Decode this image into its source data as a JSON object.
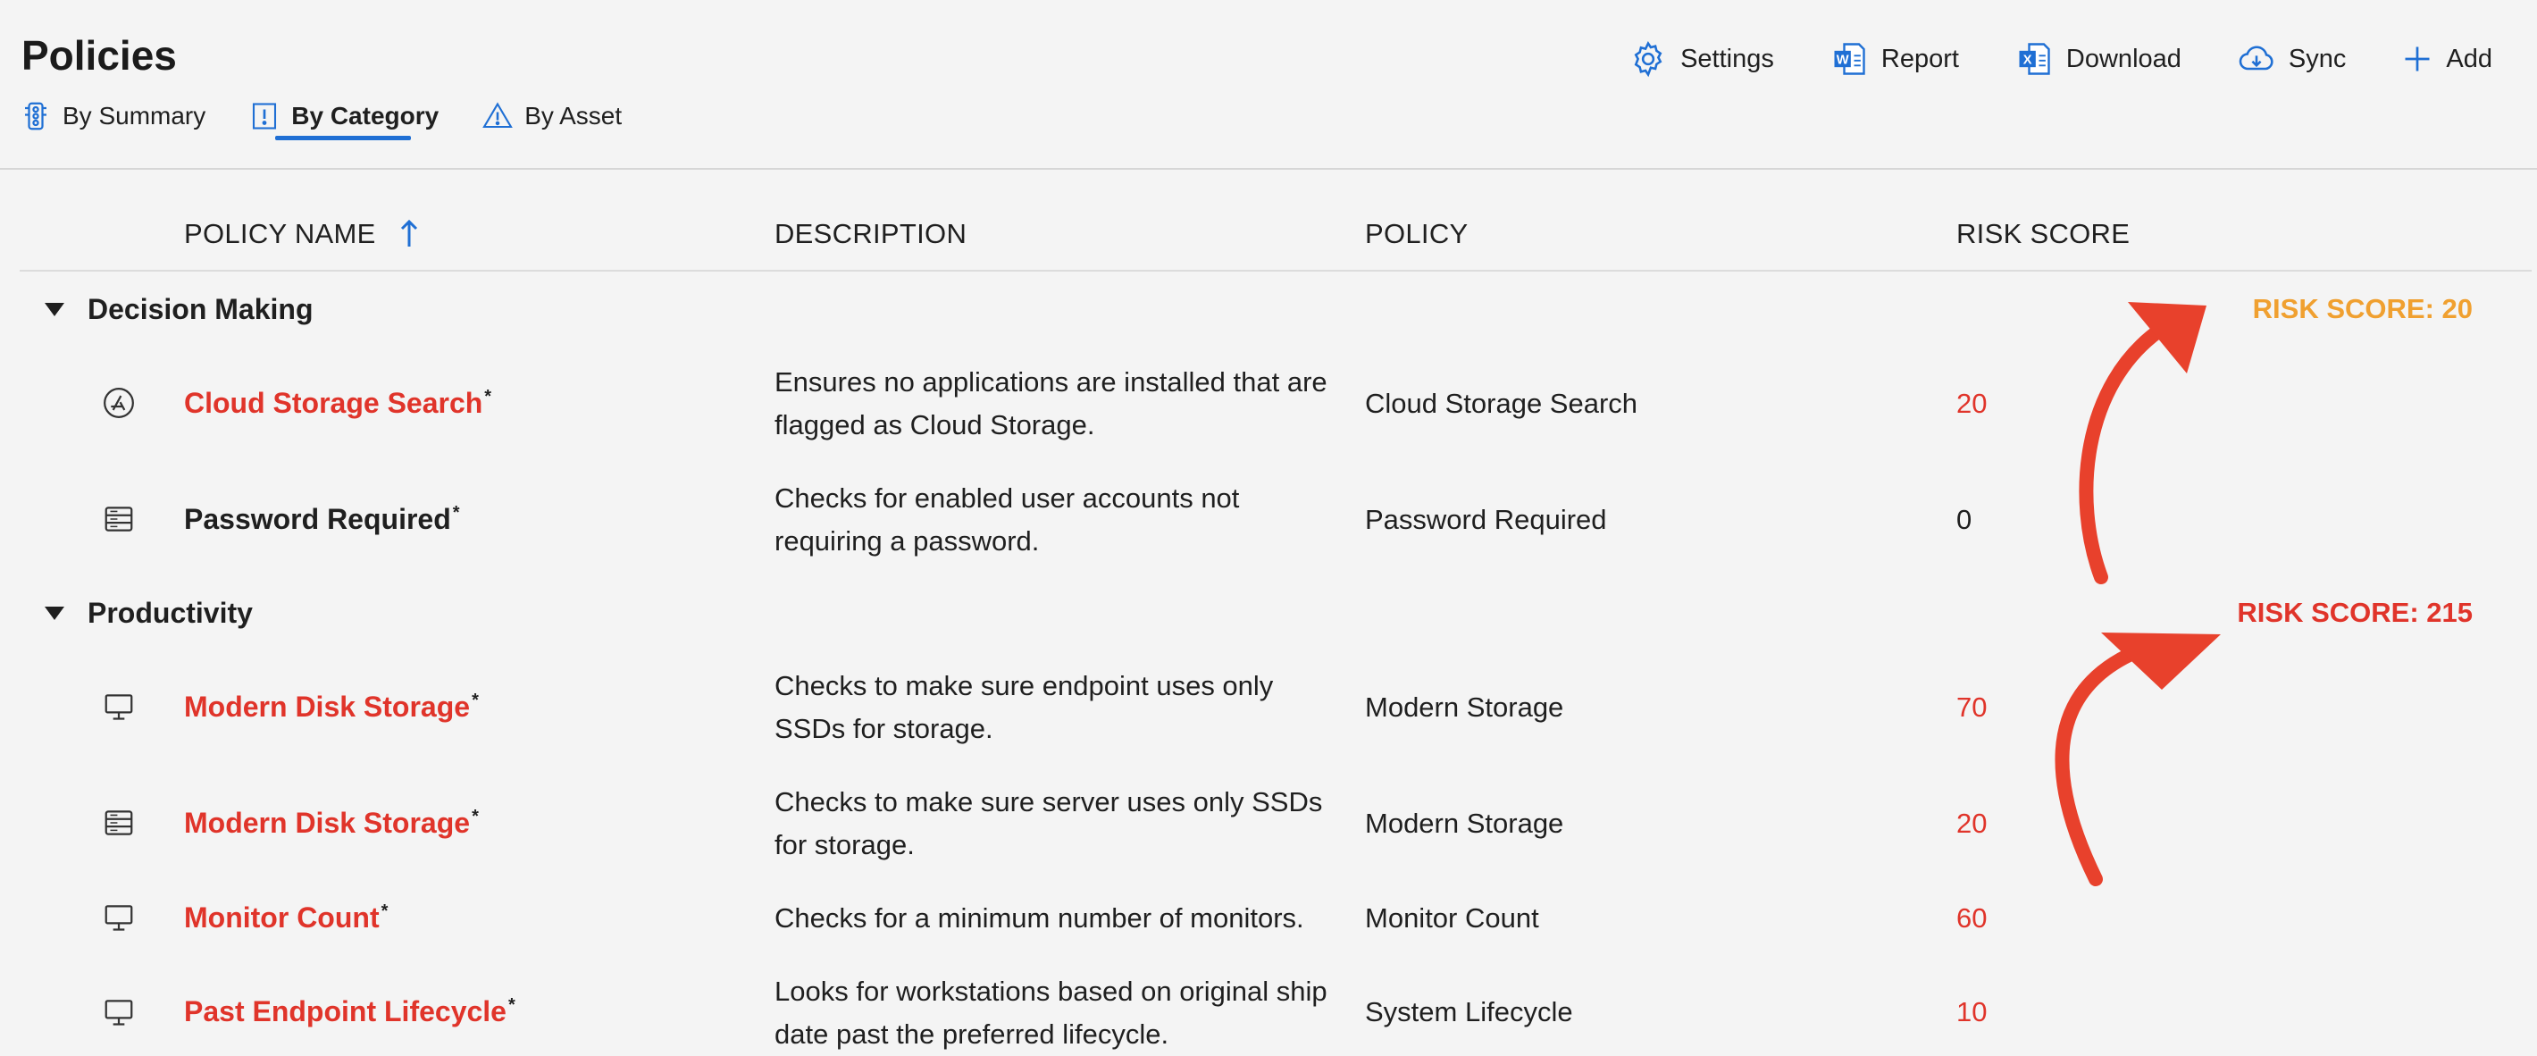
{
  "page": {
    "title": "Policies"
  },
  "toolbar": {
    "settings": "Settings",
    "report": "Report",
    "download": "Download",
    "sync": "Sync",
    "add": "Add"
  },
  "tabs": [
    {
      "label": "By Summary",
      "icon": "traffic-light-icon",
      "active": false
    },
    {
      "label": "By Category",
      "icon": "exclamation-box-icon",
      "active": true
    },
    {
      "label": "By Asset",
      "icon": "warning-triangle-icon",
      "active": false
    }
  ],
  "table": {
    "columns": [
      "POLICY NAME",
      "DESCRIPTION",
      "POLICY",
      "RISK SCORE"
    ],
    "sort": {
      "column": "POLICY NAME",
      "direction": "ascending"
    },
    "groups": [
      {
        "name": "Decision Making",
        "risk_label": "RISK SCORE: 20",
        "risk_color": "#f0a030",
        "rows": [
          {
            "icon": "app-store-icon",
            "name": "Cloud Storage Search",
            "mark": "*",
            "description": "Ensures no applications are installed that are flagged as Cloud Storage.",
            "policy": "Cloud Storage Search",
            "score": "20",
            "flagged": true
          },
          {
            "icon": "server-icon",
            "name": "Password Required",
            "mark": "*",
            "description": "Checks for enabled user accounts not requiring a password.",
            "policy": "Password Required",
            "score": "0",
            "flagged": false
          }
        ]
      },
      {
        "name": "Productivity",
        "risk_label": "RISK SCORE: 215",
        "risk_color": "#e0342a",
        "rows": [
          {
            "icon": "monitor-icon",
            "name": "Modern Disk Storage",
            "mark": "*",
            "description": "Checks to make sure endpoint uses only SSDs for storage.",
            "policy": "Modern Storage",
            "score": "70",
            "flagged": true
          },
          {
            "icon": "server-icon",
            "name": "Modern Disk Storage",
            "mark": "*",
            "description": "Checks to make sure server uses only SSDs for storage.",
            "policy": "Modern Storage",
            "score": "20",
            "flagged": true
          },
          {
            "icon": "monitor-icon",
            "name": "Monitor Count",
            "mark": "*",
            "description": "Checks for a minimum number of monitors.",
            "policy": "Monitor Count",
            "score": "60",
            "flagged": true
          },
          {
            "icon": "monitor-icon",
            "name": "Past Endpoint Lifecycle",
            "mark": "*",
            "description": "Looks for workstations based on original ship date past the preferred lifecycle.",
            "policy": "System Lifecycle",
            "score": "10",
            "flagged": true
          }
        ]
      }
    ]
  },
  "colors": {
    "accent": "#1f6fd4",
    "flagged_text": "#e0342a",
    "annotation_arrow": "#e8412c"
  }
}
